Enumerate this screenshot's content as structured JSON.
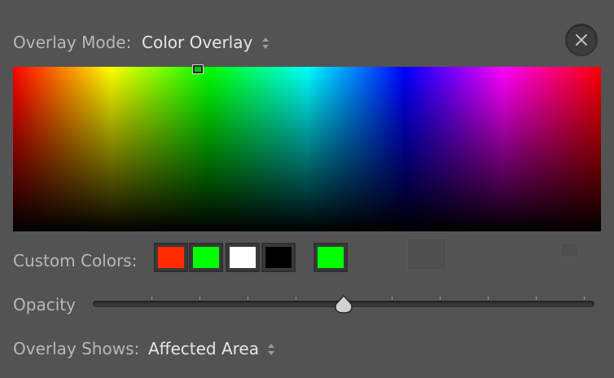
{
  "header": {
    "overlay_mode_label": "Overlay Mode:",
    "overlay_mode_value": "Color Overlay"
  },
  "color_picker": {
    "selected_color": "#00c800"
  },
  "custom_colors": {
    "label": "Custom Colors:",
    "swatches": [
      "#ff2a00",
      "#00ff00",
      "#ffffff",
      "#000000"
    ],
    "current": "#00ff00"
  },
  "opacity": {
    "label": "Opacity",
    "value_fraction": 0.5
  },
  "overlay_shows": {
    "label": "Overlay Shows:",
    "value": "Affected Area"
  },
  "icons": {
    "close": "close-icon",
    "updown": "updown-arrows-icon",
    "thumb": "slider-thumb-icon"
  }
}
